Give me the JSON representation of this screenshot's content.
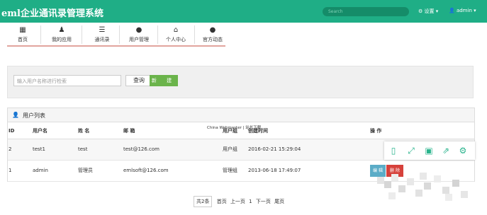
{
  "header": {
    "title": "eml企业通讯录管理系统",
    "search_placeholder": "Search",
    "settings_label": "设置",
    "user_label": "admin"
  },
  "nav": {
    "items": [
      {
        "label": "首页",
        "icon": "grid-icon"
      },
      {
        "label": "我的应用",
        "icon": "user-app-icon"
      },
      {
        "label": "通讯录",
        "icon": "list-icon"
      },
      {
        "label": "用户管理",
        "icon": "user-icon"
      },
      {
        "label": "个人中心",
        "icon": "home-icon"
      },
      {
        "label": "官方动态",
        "icon": "comment-icon"
      }
    ]
  },
  "search": {
    "placeholder": "输入用户名称进行检索",
    "query_label": "查询",
    "new_label": "新 建"
  },
  "watermark": {
    "logo": "vwngpro",
    "text": "China Webmaster | 站长下载"
  },
  "user_list": {
    "title": "用户列表",
    "columns": [
      "ID",
      "用户名",
      "姓 名",
      "邮 箱",
      "用户组",
      "创建时间",
      "操 作"
    ],
    "rows": [
      {
        "id": "2",
        "username": "test1",
        "name": "test",
        "email": "test@126.com",
        "group": "用户组",
        "created": "2016-02-21 15:29:04"
      },
      {
        "id": "1",
        "username": "admin",
        "name": "管理员",
        "email": "emlsoft@126.com",
        "group": "管理组",
        "created": "2013-06-18 17:49:07"
      }
    ],
    "edit_label": "编 辑",
    "delete_label": "删 除"
  },
  "pagination": {
    "total": "共2条",
    "first": "首页",
    "prev": "上一页",
    "current": "1",
    "next": "下一页",
    "last": "尾页"
  },
  "colors": {
    "header_green": "#1fae86",
    "new_button": "#6bb44b",
    "edit_button": "#5bacc7",
    "delete_button": "#d6413b"
  }
}
